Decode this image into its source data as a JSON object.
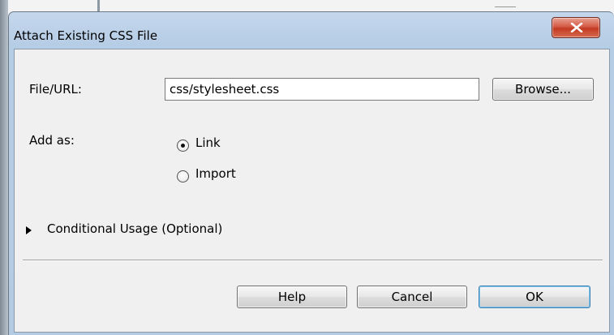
{
  "dialog": {
    "title": "Attach Existing CSS File",
    "close_icon": "close-icon"
  },
  "file_url": {
    "label": "File/URL:",
    "value": "css/stylesheet.css",
    "browse_label": "Browse..."
  },
  "add_as": {
    "label": "Add as:",
    "options": [
      {
        "label": "Link",
        "selected": true
      },
      {
        "label": "Import",
        "selected": false
      }
    ]
  },
  "conditional": {
    "label": "Conditional Usage (Optional)",
    "expanded": false
  },
  "footer": {
    "help_label": "Help",
    "cancel_label": "Cancel",
    "ok_label": "OK"
  },
  "colors": {
    "title_bar": "#b6cde6",
    "close_button": "#c9452c",
    "dialog_body": "#f0f0f0",
    "default_button_border": "#3c7fb1"
  }
}
